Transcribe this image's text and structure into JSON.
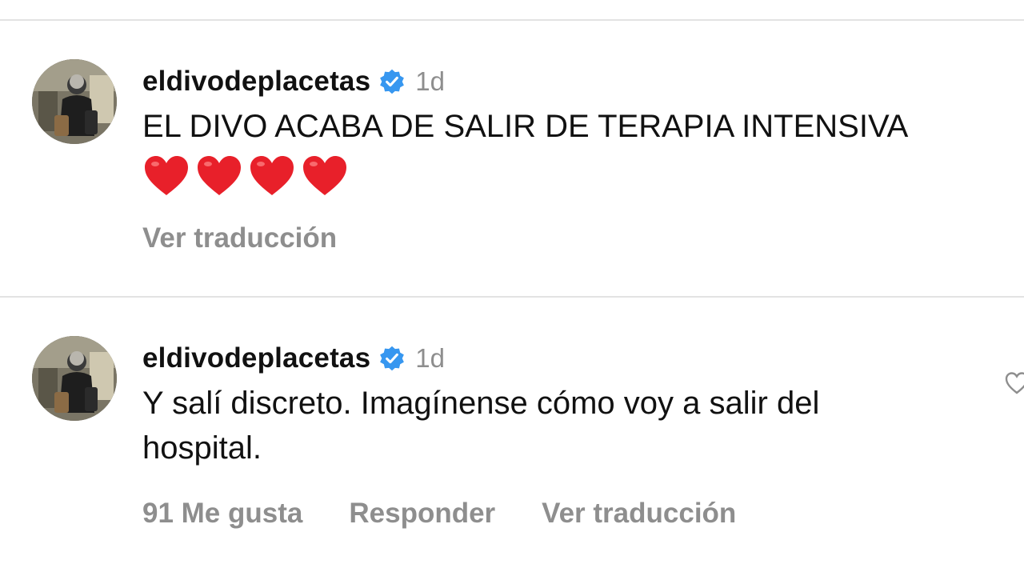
{
  "comments": [
    {
      "username": "eldivodeplacetas",
      "time": "1d",
      "text": "EL DIVO ACABA DE SALIR DE TERAPIA INTENSIVA",
      "reactions": [
        "❤️",
        "❤️",
        "❤️",
        "❤️"
      ],
      "actions": {
        "translate": "Ver traducción"
      }
    },
    {
      "username": "eldivodeplacetas",
      "time": "1d",
      "text": "Y salí discreto. Imagínense cómo voy a salir del\nhospital.",
      "actions": {
        "likes": "91 Me gusta",
        "reply": "Responder",
        "translate": "Ver traducción"
      }
    }
  ],
  "icons": {
    "verified": "verified-badge-icon",
    "heart": "red-heart-emoji",
    "like": "heart-outline-icon"
  },
  "colors": {
    "verified_blue": "#3797f0",
    "secondary_text": "#8e8e8e",
    "heart_red": "#e8202a",
    "divider": "#e3e3e3"
  }
}
